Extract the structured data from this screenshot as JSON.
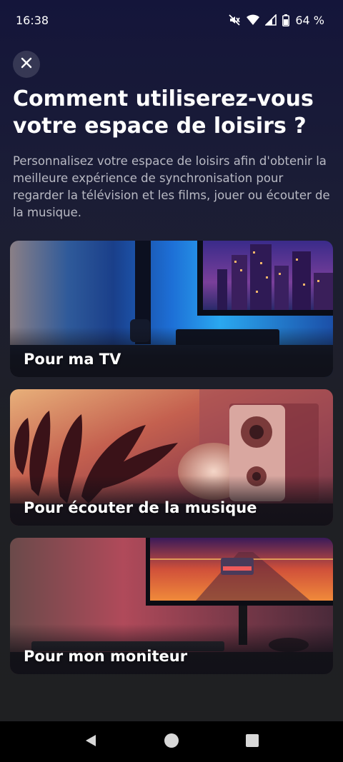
{
  "status_bar": {
    "time": "16:38",
    "battery": "64 %",
    "icons": [
      "mute-icon",
      "wifi-icon",
      "signal-icon",
      "battery-icon"
    ]
  },
  "close_icon": "close-icon",
  "title": "Comment utiliserez-vous votre espace de loisirs ?",
  "subtitle": "Personnalisez votre espace de loisirs afin d'obtenir la meilleure expérience de synchronisation pour regarder la télévision et les films, jouer ou écouter de la musique.",
  "cards": [
    {
      "label": "Pour ma TV",
      "theme": "tv"
    },
    {
      "label": "Pour écouter de la musique",
      "theme": "music"
    },
    {
      "label": "Pour mon moniteur",
      "theme": "monitor"
    }
  ],
  "nav_bar": {
    "icons": [
      "back-icon",
      "home-icon",
      "recents-icon"
    ]
  }
}
